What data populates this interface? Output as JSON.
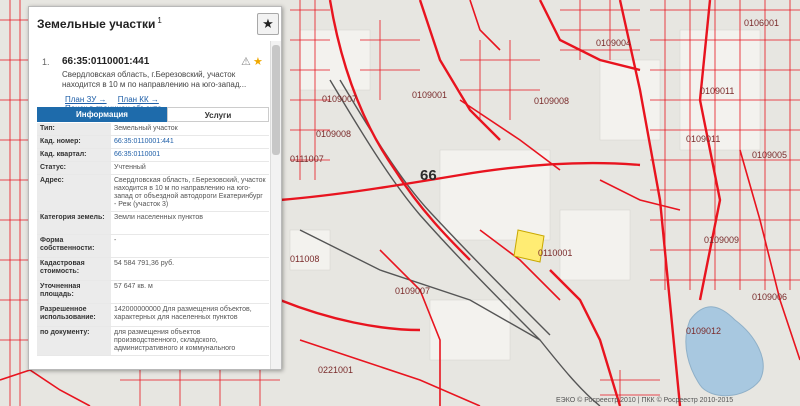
{
  "panel": {
    "title": "Земельные участки",
    "count": "1",
    "item_number": "1.",
    "cad_number": "66:35:0110001:441",
    "address_short": "Свердловская область, г.Березовский, участок находится в 10 м по направлению на юго-запад...",
    "links": [
      "План ЗУ →",
      "План КК →",
      "Поиск в границах объекта →"
    ],
    "tab_info": "Информация",
    "tab_services": "Услуги",
    "rows": [
      {
        "label": "Тип:",
        "value": "Земельный участок"
      },
      {
        "label": "Кад. номер:",
        "value": "66:35:0110001:441"
      },
      {
        "label": "Кад. квартал:",
        "value": "66:35:0110001"
      },
      {
        "label": "Статус:",
        "value": "Учтенный"
      },
      {
        "label": "Адрес:",
        "value": "Свердловская область, г.Березовский, участок находится в 10 м по направлению на юго-запад от объездной автодороги Екатеринбург - Реж (участок 3)"
      },
      {
        "label": "Категория земель:",
        "value": "Земли населенных пунктов"
      },
      {
        "label": "Форма собственности:",
        "value": "-"
      },
      {
        "label": "Кадастровая стоимость:",
        "value": "54 584 791,36 руб."
      },
      {
        "label": "Уточненная площадь:",
        "value": "57 647 кв. м"
      },
      {
        "label": "Разрешенное использование:",
        "value": "142000000000 Для размещения объектов, характерных для населенных пунктов"
      },
      {
        "label": "по документу:",
        "value": "для размещения объектов производственного, складского, административного и коммунального"
      }
    ]
  },
  "map": {
    "region_label": "66",
    "quarters": [
      "0109007",
      "0109008",
      "0111007",
      "0110001",
      "0109007",
      "0221001",
      "0109012",
      "0109004",
      "0109011",
      "0109009",
      "0109008",
      "0109011",
      "011008",
      "0109005",
      "0106001",
      "0109006",
      "0109001"
    ],
    "copyright": "ЕЭКО © Росреестр 2010 | ПКК © Росреестр 2010-2015"
  },
  "colors": {
    "boundary": "#e8141f",
    "highlight": "#ffec73",
    "accent": "#1e6bab"
  }
}
